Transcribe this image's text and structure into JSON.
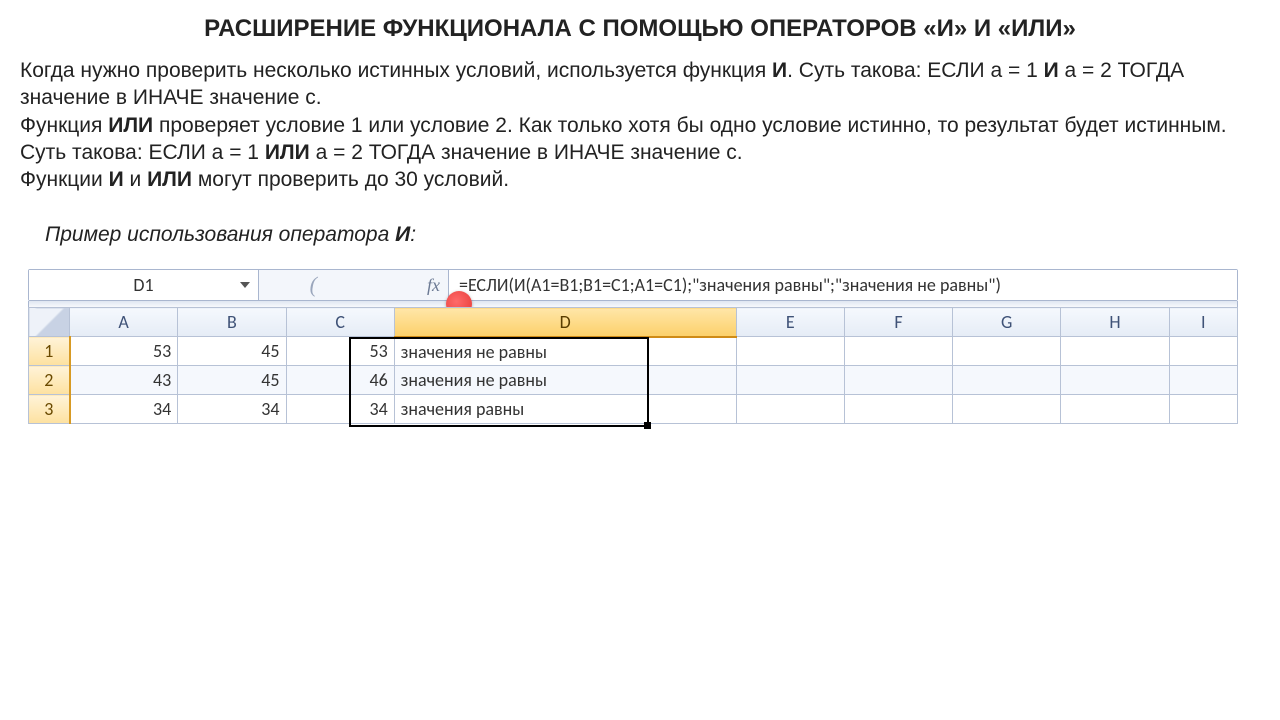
{
  "title": "РАСШИРЕНИЕ ФУНКЦИОНАЛА С ПОМОЩЬЮ ОПЕРАТОРОВ «И» И «ИЛИ»",
  "paragraph": {
    "p1a": "Когда нужно проверить несколько истинных условий, используется функция ",
    "p1b": "И",
    "p1c": ". Суть такова: ЕСЛИ а = 1 ",
    "p1d": "И",
    "p1e": " а = 2 ТОГДА значение в ИНАЧЕ значение с.",
    "p2a": "Функция ",
    "p2b": "ИЛИ",
    "p2c": " проверяет условие 1 или условие 2. Как только хотя бы одно условие истинно, то результат будет истинным. Суть такова: ЕСЛИ а = 1 ",
    "p2d": "ИЛИ",
    "p2e": " а = 2 ТОГДА значение в ИНАЧЕ значение с.",
    "p3a": "Функции ",
    "p3b": "И",
    "p3c": " и ",
    "p3d": "ИЛИ",
    "p3e": " могут проверить до 30 условий."
  },
  "example_label_pre": "Пример использования оператора ",
  "example_label_bold": "И",
  "example_label_post": ":",
  "excel": {
    "name_box": "D1",
    "fx_label": "fx",
    "formula": "=ЕСЛИ(И(A1=B1;B1=C1;A1=C1);\"значения равны\";\"значения не равны\")",
    "columns": [
      "A",
      "B",
      "C",
      "D",
      "E",
      "F",
      "G",
      "H",
      "I"
    ],
    "rows": [
      {
        "n": "1",
        "A": "53",
        "B": "45",
        "C": "53",
        "D": "значения не равны"
      },
      {
        "n": "2",
        "A": "43",
        "B": "45",
        "C": "46",
        "D": "значения не равны"
      },
      {
        "n": "3",
        "A": "34",
        "B": "34",
        "C": "34",
        "D": "значения равны"
      }
    ]
  }
}
